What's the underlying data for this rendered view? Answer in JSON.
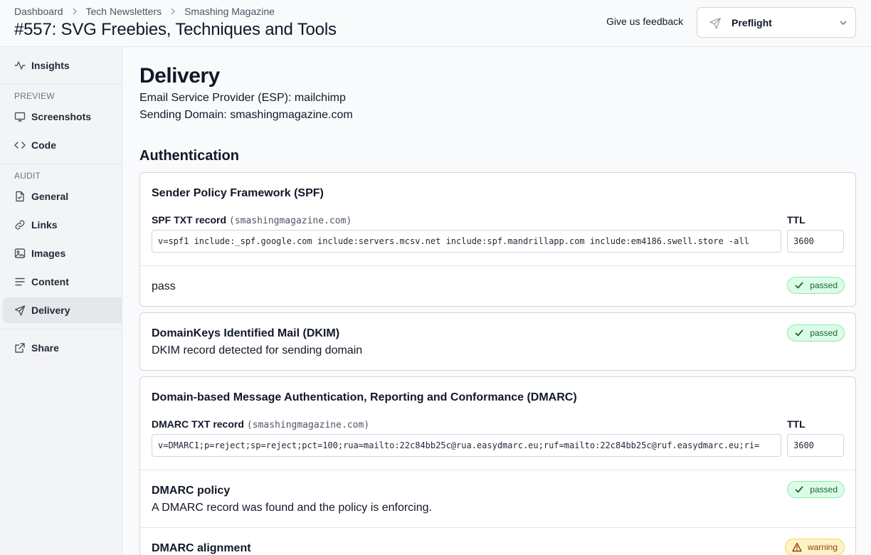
{
  "header": {
    "breadcrumb": [
      "Dashboard",
      "Tech Newsletters",
      "Smashing Magazine"
    ],
    "title": "#557: SVG Freebies, Techniques and Tools",
    "feedback": "Give us feedback",
    "project_select": "Preflight"
  },
  "sidebar": {
    "insights": "Insights",
    "preview_section": "PREVIEW",
    "screenshots": "Screenshots",
    "code": "Code",
    "audit_section": "AUDIT",
    "general": "General",
    "links": "Links",
    "images": "Images",
    "content": "Content",
    "delivery": "Delivery",
    "share": "Share"
  },
  "main": {
    "title": "Delivery",
    "esp": "Email Service Provider (ESP): mailchimp",
    "domain": "Sending Domain: smashingmagazine.com",
    "auth_heading": "Authentication"
  },
  "spf": {
    "title": "Sender Policy Framework (SPF)",
    "record_label": "SPF TXT record",
    "record_domain": "(smashingmagazine.com)",
    "ttl_label": "TTL",
    "record": "v=spf1 include:_spf.google.com include:servers.mcsv.net include:spf.mandrillapp.com include:em4186.swell.store -all",
    "ttl": "3600",
    "result": "pass",
    "status": "passed"
  },
  "dkim": {
    "title": "DomainKeys Identified Mail (DKIM)",
    "text": "DKIM record detected for sending domain",
    "status": "passed"
  },
  "dmarc": {
    "title": "Domain-based Message Authentication, Reporting and Conformance (DMARC)",
    "record_label": "DMARC TXT record",
    "record_domain": "(smashingmagazine.com)",
    "ttl_label": "TTL",
    "record": "v=DMARC1;p=reject;sp=reject;pct=100;rua=mailto:22c84bb25c@rua.easydmarc.eu;ruf=mailto:22c84bb25c@ruf.easydmarc.eu;ri=",
    "ttl": "3600",
    "policy_title": "DMARC policy",
    "policy_text": "A DMARC record was found and the policy is enforcing.",
    "policy_status": "passed",
    "alignment_title": "DMARC alignment",
    "alignment_status": "warning"
  },
  "colors": {
    "pass_bg": "#dcfce7",
    "pass_text": "#166534",
    "warn_bg": "#fef3c7",
    "warn_text": "#92400e"
  }
}
